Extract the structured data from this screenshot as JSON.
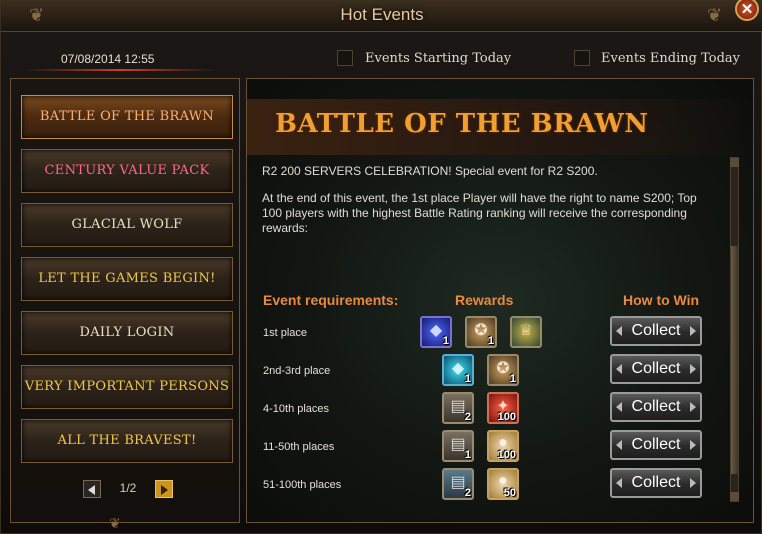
{
  "window": {
    "title": "Hot Events",
    "close_glyph": "✕"
  },
  "header": {
    "date": "07/08/2014 12:55",
    "filter_starting": "Events Starting Today",
    "filter_ending": "Events Ending Today"
  },
  "sidebar": {
    "items": [
      {
        "label": "BATTLE OF THE BRAWN",
        "active": true
      },
      {
        "label": "CENTURY VALUE PACK"
      },
      {
        "label": "GLACIAL WOLF"
      },
      {
        "label": "LET THE GAMES BEGIN!"
      },
      {
        "label": "DAILY LOGIN"
      },
      {
        "label": "VERY IMPORTANT PERSONS"
      },
      {
        "label": "ALL THE BRAVEST!"
      }
    ],
    "pager": "1/2"
  },
  "event": {
    "title": "BATTLE OF THE BRAWN",
    "description_1": "R2 200 SERVERS CELEBRATION! Special event for R2 S200.",
    "description_2": "At the end of this event, the 1st place Player will have the right to name S200; Top 100 players with the highest Battle Rating ranking will receive the corresponding rewards:",
    "headers": {
      "requirements": "Event requirements:",
      "rewards": "Rewards",
      "how_to_win": "How to Win"
    },
    "rows": [
      {
        "label": "1st place",
        "rewards": [
          {
            "icon": "blue-gem-icon",
            "qty": "1"
          },
          {
            "icon": "medal-icon",
            "qty": "1"
          },
          {
            "icon": "trophy-icon",
            "qty": ""
          }
        ],
        "action": "Collect"
      },
      {
        "label": "2nd-3rd place",
        "rewards": [
          {
            "icon": "cyan-gem-icon",
            "qty": "1"
          },
          {
            "icon": "medal-icon",
            "qty": "1"
          }
        ],
        "action": "Collect"
      },
      {
        "label": "4-10th places",
        "rewards": [
          {
            "icon": "chest-icon",
            "qty": "2"
          },
          {
            "icon": "red-pack-icon",
            "qty": "100"
          }
        ],
        "action": "Collect"
      },
      {
        "label": "11-50th places",
        "rewards": [
          {
            "icon": "chest-icon",
            "qty": "1"
          },
          {
            "icon": "orb-icon",
            "qty": "100"
          }
        ],
        "action": "Collect"
      },
      {
        "label": "51-100th places",
        "rewards": [
          {
            "icon": "blue-chest-icon",
            "qty": "2"
          },
          {
            "icon": "orb-icon",
            "qty": "50"
          }
        ],
        "action": "Collect"
      }
    ]
  }
}
